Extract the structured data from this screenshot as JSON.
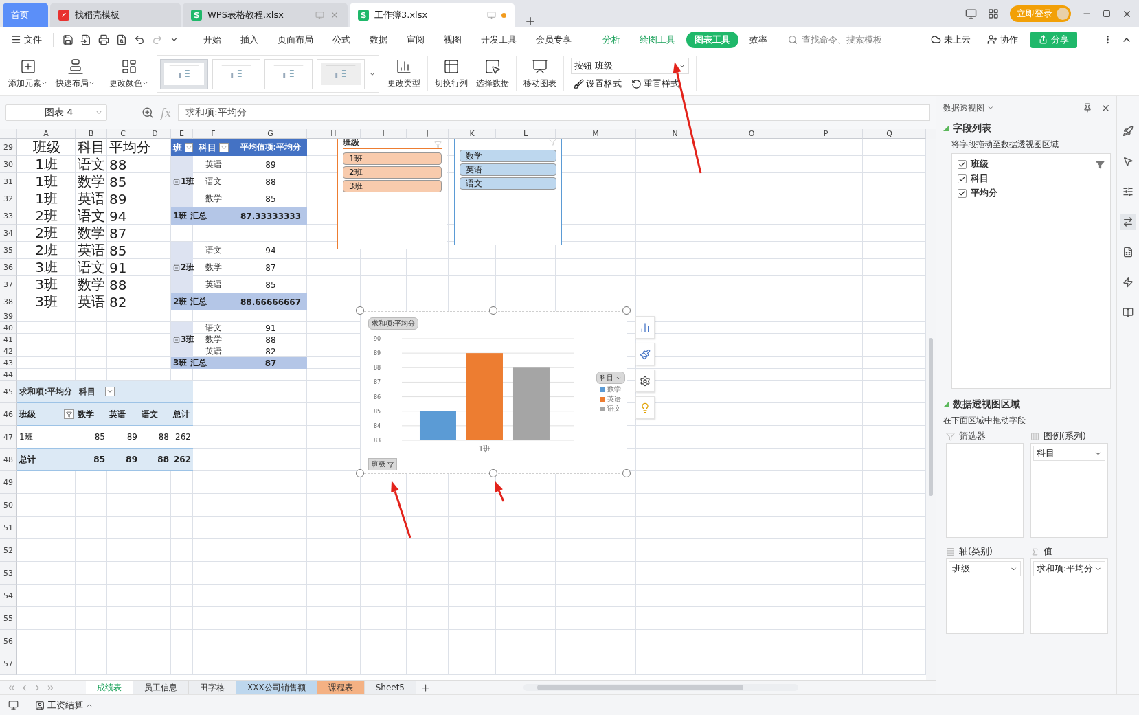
{
  "title_tabs": [
    {
      "label": "首页",
      "kind": "home",
      "selected": false
    },
    {
      "label": "找稻壳模板",
      "kind": "docer",
      "selected": false
    },
    {
      "label": "WPS表格教程.xlsx",
      "kind": "sheet",
      "selected": false,
      "unsaved": false
    },
    {
      "label": "工作簿3.xlsx",
      "kind": "sheet",
      "selected": true,
      "unsaved": true
    }
  ],
  "login": "立即登录",
  "menu": {
    "file": "文件",
    "tabs": [
      {
        "label": "开始",
        "kind": "main",
        "selected": false
      },
      {
        "label": "插入",
        "kind": "main",
        "selected": false
      },
      {
        "label": "页面布局",
        "kind": "main",
        "selected": false
      },
      {
        "label": "公式",
        "kind": "main",
        "selected": false
      },
      {
        "label": "数据",
        "kind": "main",
        "selected": false
      },
      {
        "label": "审阅",
        "kind": "main",
        "selected": false
      },
      {
        "label": "视图",
        "kind": "main",
        "selected": false
      },
      {
        "label": "开发工具",
        "kind": "main",
        "selected": false
      },
      {
        "label": "会员专享",
        "kind": "main",
        "selected": false
      },
      {
        "label": "分析",
        "kind": "context",
        "selected": false
      },
      {
        "label": "绘图工具",
        "kind": "context",
        "selected": false
      },
      {
        "label": "图表工具",
        "kind": "context",
        "selected": true
      },
      {
        "label": "效率",
        "kind": "main",
        "selected": false
      }
    ],
    "search": {
      "placeholder": "查找命令、搜索模板"
    },
    "cloud": "未上云",
    "collab": "协作",
    "share": "分享"
  },
  "ribbon": {
    "tools_before": [
      {
        "label": "添加元素",
        "kind": "add",
        "dropdown": true
      },
      {
        "label": "快速布局",
        "kind": "layout",
        "dropdown": true
      },
      {
        "label": "更改颜色",
        "kind": "color",
        "dropdown": true
      }
    ],
    "gallery": [
      {
        "selected": true
      },
      {
        "selected": false
      },
      {
        "selected": false
      },
      {
        "selected": false
      }
    ],
    "tools_after": [
      {
        "label": "更改类型",
        "kind": "type"
      },
      {
        "label": "切换行列",
        "kind": "switch"
      },
      {
        "label": "选择数据",
        "kind": "select"
      },
      {
        "label": "移动图表",
        "kind": "move"
      }
    ],
    "element_select": "按钮 班级",
    "format_tools": [
      {
        "label": "设置格式",
        "kind": "format"
      },
      {
        "label": "重置样式",
        "kind": "reset"
      }
    ]
  },
  "formula_bar": {
    "name_box": "图表 4",
    "fx": "fx",
    "formula": "求和项:平均分"
  },
  "sheet": {
    "columns": [
      "A",
      "B",
      "C",
      "D",
      "E",
      "F",
      "G",
      "H",
      "I",
      "J",
      "K",
      "L",
      "M",
      "N",
      "O",
      "P",
      "Q"
    ],
    "rows": [
      "29",
      "30",
      "31",
      "32",
      "33",
      "34",
      "35",
      "36",
      "37",
      "38",
      "39",
      "40",
      "41",
      "42",
      "43",
      "44",
      "45",
      "46",
      "47",
      "48",
      "49",
      "50",
      "51",
      "52",
      "53",
      "54",
      "55",
      "56",
      "57"
    ],
    "source_table": {
      "header": [
        "班级",
        "科目",
        "平均分"
      ],
      "rows": [
        [
          "1班",
          "语文",
          "88"
        ],
        [
          "1班",
          "数学",
          "85"
        ],
        [
          "1班",
          "英语",
          "89"
        ],
        [
          "2班",
          "语文",
          "94"
        ],
        [
          "2班",
          "数学",
          "87"
        ],
        [
          "2班",
          "英语",
          "85"
        ],
        [
          "3班",
          "语文",
          "91"
        ],
        [
          "3班",
          "数学",
          "88"
        ],
        [
          "3班",
          "英语",
          "82"
        ]
      ]
    },
    "pivot": {
      "header": [
        "班",
        "科目",
        "平均值项:平均分"
      ],
      "groups": [
        {
          "label": "1班",
          "expanded": true,
          "items": [
            {
              "subject": "英语",
              "value": "89"
            },
            {
              "subject": "语文",
              "value": "88"
            },
            {
              "subject": "数学",
              "value": "85"
            }
          ],
          "total_label": "1班 汇总",
          "total": "87.33333333"
        },
        {
          "label": "2班",
          "expanded": true,
          "items": [
            {
              "subject": "语文",
              "value": "94"
            },
            {
              "subject": "数学",
              "value": "87"
            },
            {
              "subject": "英语",
              "value": "85"
            }
          ],
          "total_label": "2班 汇总",
          "total": "88.66666667"
        },
        {
          "label": "3班",
          "expanded": true,
          "items": [
            {
              "subject": "语文",
              "value": "91"
            },
            {
              "subject": "数学",
              "value": "88"
            },
            {
              "subject": "英语",
              "value": "82"
            }
          ],
          "total_label": "3班 汇总",
          "total": "87"
        }
      ]
    },
    "pivot_2": {
      "value_label": "求和项:平均分",
      "column_field": "科目",
      "row_field": "班级",
      "columns": [
        "数学",
        "英语",
        "语文",
        "总计"
      ],
      "rows": [
        {
          "label": "1班",
          "kind": "data",
          "values": [
            "85",
            "89",
            "88",
            "262"
          ]
        },
        {
          "label": "总计",
          "kind": "total",
          "values": [
            "85",
            "89",
            "88",
            "262"
          ]
        }
      ]
    },
    "slicers": [
      {
        "title": "班级",
        "color": "#ed7d31",
        "items": [
          {
            "label": "1班",
            "selected": true
          },
          {
            "label": "2班",
            "selected": true
          },
          {
            "label": "3班",
            "selected": true
          }
        ]
      },
      {
        "color": "#5b9bd5",
        "items": [
          {
            "label": "数学",
            "selected": true
          },
          {
            "label": "英语",
            "selected": true
          },
          {
            "label": "语文",
            "selected": true
          }
        ]
      }
    ],
    "chart": {
      "legend_field": "科目",
      "axis_field": "班级",
      "chart_data": {
        "type": "bar",
        "title": "求和项:平均分",
        "categories": [
          "1班"
        ],
        "series": [
          {
            "name": "数学",
            "color": "#5b9bd5",
            "values": [
              85
            ]
          },
          {
            "name": "英语",
            "color": "#ed7d31",
            "values": [
              89
            ]
          },
          {
            "name": "语文",
            "color": "#a5a5a5",
            "values": [
              88
            ]
          }
        ],
        "grid": true,
        "ylim": [
          83,
          90
        ],
        "yticks": [
          83,
          84,
          85,
          86,
          87,
          88,
          89,
          90
        ]
      }
    }
  },
  "sheet_tabs": [
    {
      "label": "成绩表",
      "selected": true
    },
    {
      "label": "员工信息",
      "selected": false
    },
    {
      "label": "田字格",
      "selected": false
    },
    {
      "label": "XXX公司销售额",
      "selected": false,
      "color": "#bdd7ee"
    },
    {
      "label": "课程表",
      "selected": false,
      "color": "#f4b183"
    },
    {
      "label": "Sheet5",
      "selected": false
    }
  ],
  "status_bar": {
    "workbook": "工资结算"
  },
  "side_panel": {
    "title": "数据透视图",
    "field_section": "字段列表",
    "field_hint": "将字段拖动至数据透视图区域",
    "fields": [
      {
        "label": "班级",
        "checked": true,
        "filtered": true
      },
      {
        "label": "科目",
        "checked": true,
        "filtered": false
      },
      {
        "label": "平均分",
        "checked": true,
        "filtered": false
      }
    ],
    "area_section": "数据透视图区域",
    "area_hint": "在下面区域中拖动字段",
    "zones": [
      {
        "label": "筛选器",
        "kind": "filter"
      },
      {
        "label": "图例(系列)",
        "kind": "legend",
        "field": "科目"
      },
      {
        "label": "轴(类别)",
        "kind": "axis",
        "field": "班级"
      },
      {
        "label": "值",
        "kind": "values",
        "field": "求和项:平均分"
      }
    ]
  }
}
